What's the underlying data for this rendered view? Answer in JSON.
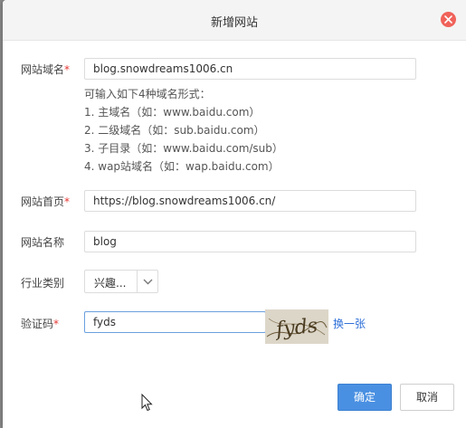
{
  "dialog": {
    "title": "新增网站"
  },
  "form": {
    "domain": {
      "label": "网站域名",
      "required_mark": "*",
      "value": "blog.snowdreams1006.cn",
      "hint": [
        "可输入如下4种域名形式：",
        "1. 主域名（如：www.baidu.com）",
        "2. 二级域名（如：sub.baidu.com）",
        "3. 子目录（如：www.baidu.com/sub）",
        "4. wap站域名（如：wap.baidu.com）"
      ]
    },
    "homepage": {
      "label": "网站首页",
      "required_mark": "*",
      "value": "https://blog.snowdreams1006.cn/"
    },
    "site_name": {
      "label": "网站名称",
      "value": "blog"
    },
    "industry": {
      "label": "行业类别",
      "selected": "兴趣..."
    },
    "captcha": {
      "label": "验证码",
      "required_mark": "*",
      "value": "fyds",
      "image_text": "fyds",
      "refresh_label": "换一张"
    }
  },
  "buttons": {
    "ok": "确定",
    "cancel": "取消"
  },
  "colors": {
    "primary": "#4a90e2",
    "close": "#f0625a",
    "required": "#e53935",
    "link": "#2f70d8"
  }
}
